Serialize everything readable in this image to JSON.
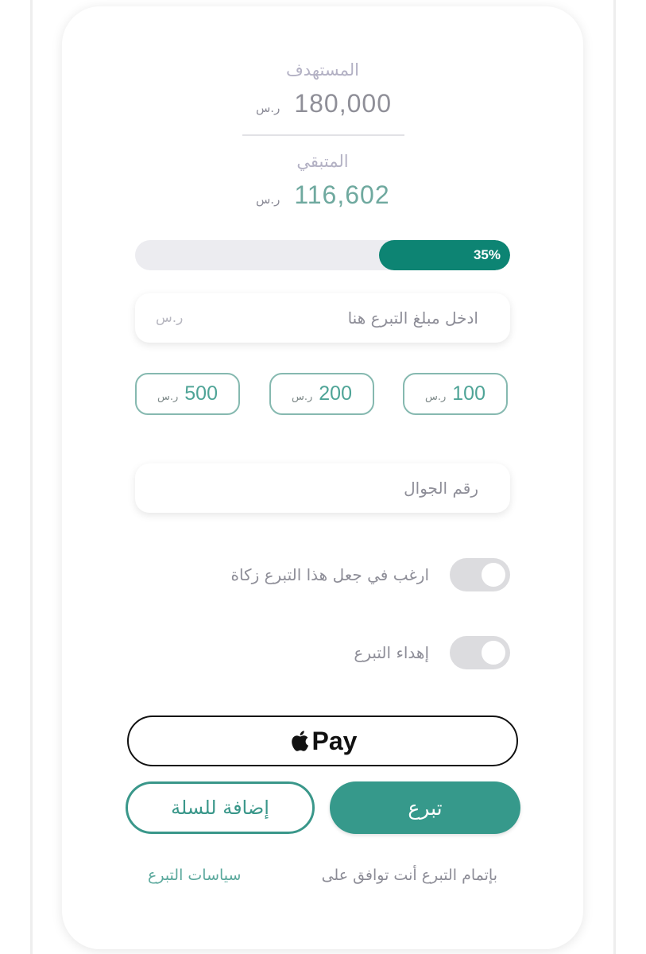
{
  "target": {
    "label": "المستهدف",
    "value": "180,000",
    "currency": "ر.س"
  },
  "remaining": {
    "label": "المتبقي",
    "value": "116,602",
    "currency": "ر.س"
  },
  "progress": {
    "percent": 35,
    "label": "35%"
  },
  "amount_input": {
    "placeholder": "ادخل مبلغ التبرع هنا",
    "currency": "ر.س"
  },
  "quick_amounts": [
    {
      "value": "100",
      "currency": "ر.س"
    },
    {
      "value": "200",
      "currency": "ر.س"
    },
    {
      "value": "500",
      "currency": "ر.س"
    }
  ],
  "phone_input": {
    "placeholder": "رقم الجوال"
  },
  "toggles": {
    "zakat": {
      "label": "ارغب في جعل هذا التبرع زكاة",
      "on": false
    },
    "gift": {
      "label": "إهداء التبرع",
      "on": false
    }
  },
  "apple_pay": {
    "icon": "apple-logo",
    "label": "Pay"
  },
  "buttons": {
    "donate": "تبرع",
    "add_to_cart": "إضافة للسلة"
  },
  "footer": {
    "agree_text": "بإتمام التبرع أنت توافق على",
    "policies_link": "سياسات التبرع"
  },
  "colors": {
    "accent": "#0d8473",
    "button": "#36998b",
    "muted": "#8e8e98"
  }
}
